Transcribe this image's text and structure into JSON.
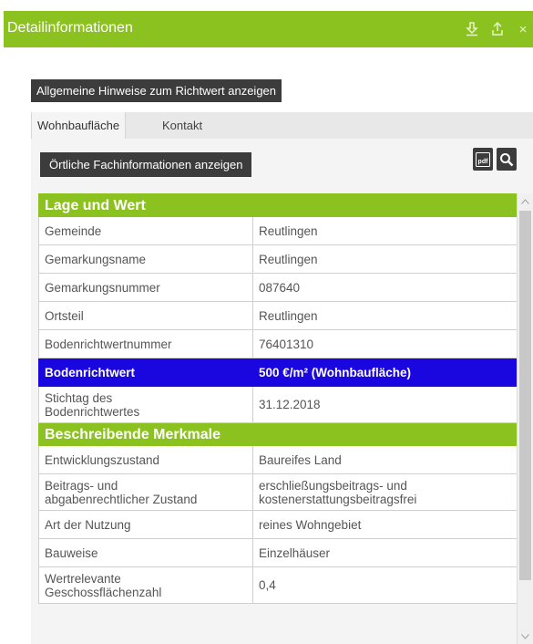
{
  "window": {
    "title": "Detailinformationen",
    "icons": [
      "download-icon",
      "export-icon",
      "close-icon"
    ],
    "close_glyph": "×"
  },
  "hint_button": "Allgemeine Hinweise zum Richtwert anzeigen",
  "tabs": [
    {
      "label": "Wohnbaufläche",
      "active": true
    },
    {
      "label": "Kontakt",
      "active": false
    }
  ],
  "fach_button": "Örtliche Fachinformationen anzeigen",
  "toolbar_icons": [
    "pdf-icon",
    "zoom-icon"
  ],
  "pdf_glyph": "pdf",
  "sections": {
    "lage": "Lage und Wert",
    "merkmale": "Beschreibende Merkmale"
  },
  "rows": {
    "gemeinde": {
      "label": "Gemeinde",
      "value": "Reutlingen"
    },
    "gemarkungsname": {
      "label": "Gemarkungsname",
      "value": "Reutlingen"
    },
    "gemarkungsnummer": {
      "label": "Gemarkungsnummer",
      "value": "087640"
    },
    "ortsteil": {
      "label": "Ortsteil",
      "value": "Reutlingen"
    },
    "brwnummer": {
      "label": "Bodenrichtwertnummer",
      "value": "76401310"
    },
    "bodenrichtwert": {
      "label": "Bodenrichtwert",
      "value": "500 €/m² (Wohnbaufläche)"
    },
    "stichtag": {
      "label_line1": "Stichtag des",
      "label_line2": "Bodenrichtwertes",
      "value": "31.12.2018"
    },
    "entwicklung": {
      "label": "Entwicklungszustand",
      "value": "Baureifes Land"
    },
    "beitrag": {
      "label_line1": "Beitrags- und",
      "label_line2": "abgabenrechtlicher Zustand",
      "value_line1": "erschließungsbeitrags- und",
      "value_line2": "kostenerstattungsbeitragsfrei"
    },
    "nutzung": {
      "label": "Art der Nutzung",
      "value": "reines Wohngebiet"
    },
    "bauweise": {
      "label": "Bauweise",
      "value": "Einzelhäuser"
    },
    "gfz": {
      "label_line1": "Wertrelevante",
      "label_line2": "Geschossflächenzahl",
      "value": "0,4"
    }
  },
  "colors": {
    "accent_green": "#8cc21f",
    "highlight_blue": "#1a07e0",
    "button_dark": "#3c3c3c"
  }
}
